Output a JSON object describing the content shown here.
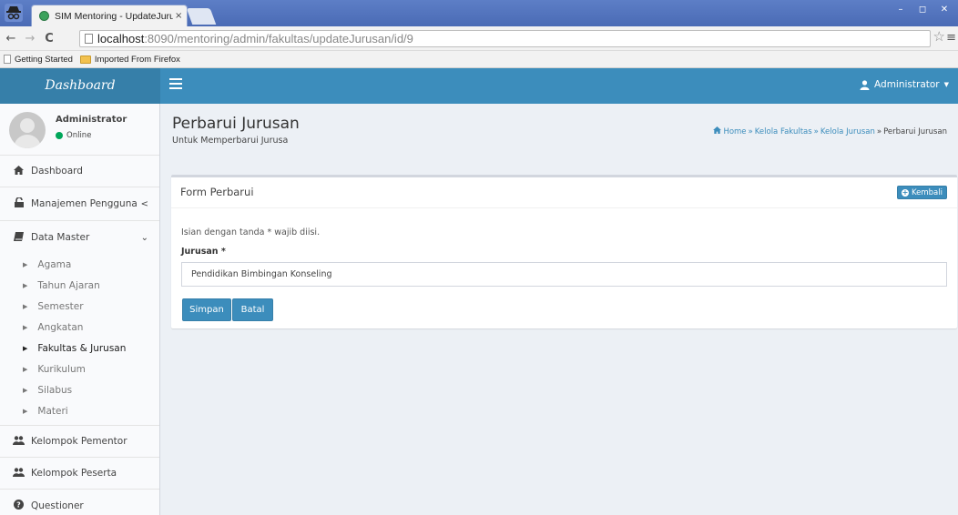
{
  "browser": {
    "tab_title": "SIM Mentoring - UpdateJuru:",
    "tab_close": "×",
    "url_host": "localhost",
    "url_path": ":8090/mentoring/admin/fakultas/updateJurusan/id/9",
    "bookmarks": [
      "Getting Started",
      "Imported From Firefox"
    ]
  },
  "header": {
    "logo": "Dashboard",
    "user": "Administrator"
  },
  "sidebar": {
    "user_name": "Administrator",
    "user_status": "Online",
    "items": [
      {
        "label": "Dashboard",
        "icon": "home-icon"
      },
      {
        "label": "Manajemen Pengguna",
        "icon": "unlock-icon",
        "caret": "<"
      },
      {
        "label": "Data Master",
        "icon": "book-icon",
        "caret": "⌄"
      }
    ],
    "submenu": [
      "Agama",
      "Tahun Ajaran",
      "Semester",
      "Angkatan",
      "Fakultas & Jurusan",
      "Kurikulum",
      "Silabus",
      "Materi"
    ],
    "active_submenu": "Fakultas & Jurusan",
    "bottom_items": [
      {
        "label": "Kelompok Pementor",
        "icon": "users-icon"
      },
      {
        "label": "Kelompok Peserta",
        "icon": "users-icon"
      },
      {
        "label": "Questioner",
        "icon": "question-circle-icon"
      }
    ]
  },
  "page": {
    "title": "Perbarui Jurusan",
    "subtitle": "Untuk Memperbarui Jurusa",
    "breadcrumb": [
      "Home",
      "Kelola Fakultas",
      "Kelola Jurusan",
      "Perbarui Jurusan"
    ],
    "breadcrumb_sep": "»"
  },
  "form": {
    "title": "Form Perbarui",
    "back_label": "Kembali",
    "note": "Isian dengan tanda * wajib diisi.",
    "field_label": "Jurusan *",
    "field_value": "Pendidikan Bimbingan Konseling",
    "save_label": "Simpan",
    "cancel_label": "Batal"
  },
  "colors": {
    "primary": "#3c8dbc",
    "logo_bg": "#367fa9",
    "online": "#00a65a"
  }
}
